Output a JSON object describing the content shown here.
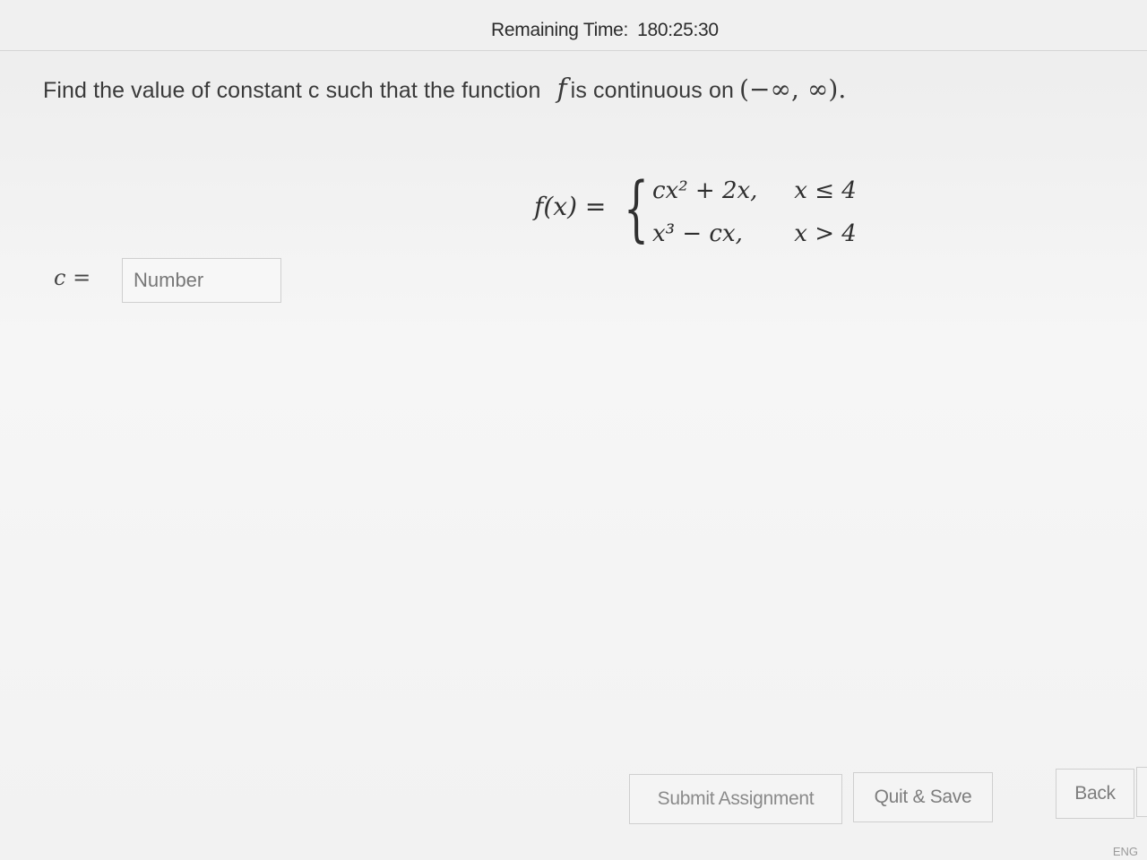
{
  "header": {
    "timer_label": "Remaining Time:",
    "timer_value": "180:25:30"
  },
  "question": {
    "text": "Find the value of constant c such that the function",
    "function_symbol": "f",
    "text_after": "is continuous on",
    "interval": "(−∞, ∞)."
  },
  "formula": {
    "lhs": "f(x) =",
    "pieces": [
      {
        "expression": "cx² + 2x,",
        "condition": "x ≤ 4"
      },
      {
        "expression": "x³ − cx,",
        "condition": "x > 4"
      }
    ]
  },
  "answer": {
    "label": "c =",
    "placeholder": "Number",
    "value": ""
  },
  "footer": {
    "submit_label": "Submit Assignment",
    "quit_label": "Quit & Save",
    "back_label": "Back"
  },
  "taskbar": {
    "language": "ENG"
  }
}
